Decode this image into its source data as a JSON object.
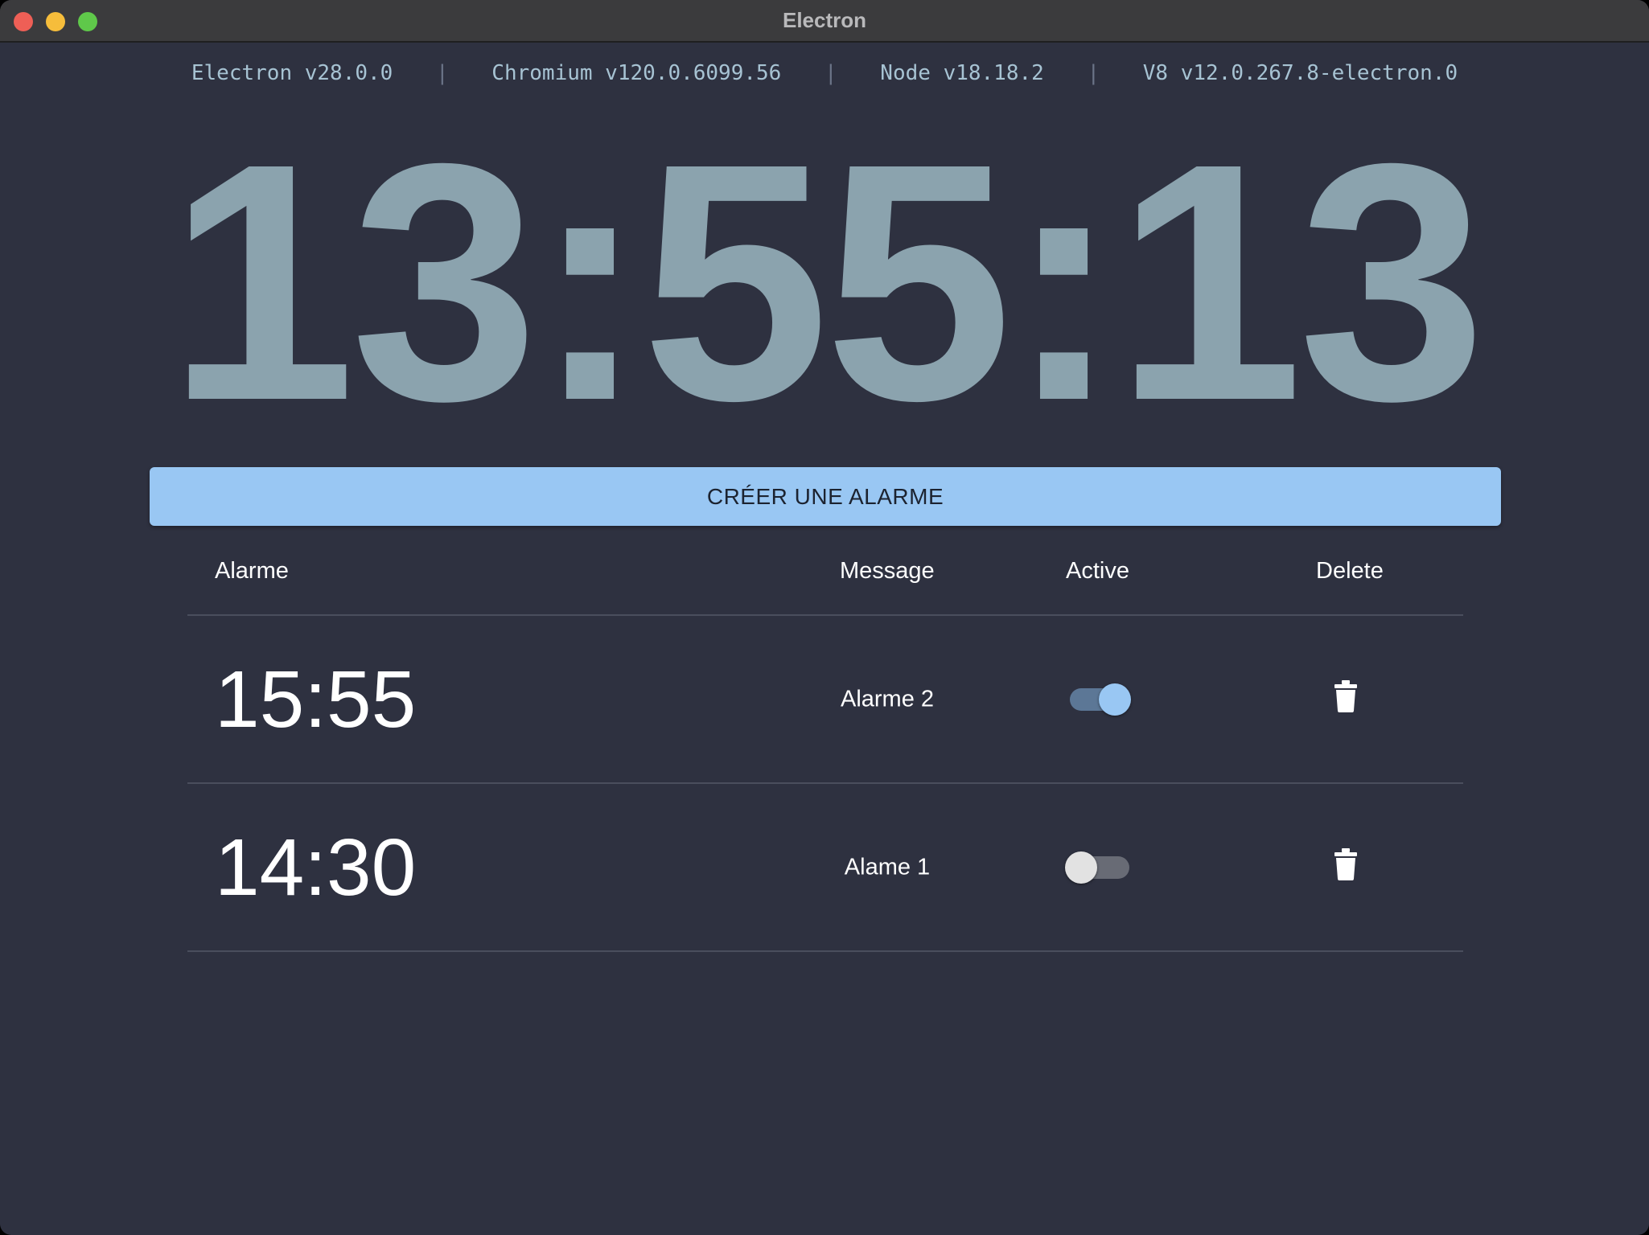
{
  "window": {
    "title": "Electron"
  },
  "versions": {
    "electron": "Electron v28.0.0",
    "chromium": "Chromium v120.0.6099.56",
    "node": "Node v18.18.2",
    "v8": "V8 v12.0.267.8-electron.0"
  },
  "clock": {
    "time": "13:55:13"
  },
  "create_button": {
    "label": "CRÉER UNE ALARME"
  },
  "table": {
    "headers": {
      "alarm": "Alarme",
      "message": "Message",
      "active": "Active",
      "delete": "Delete"
    },
    "rows": [
      {
        "time": "15:55",
        "message": "Alarme 2",
        "active": true
      },
      {
        "time": "14:30",
        "message": "Alame 1",
        "active": false
      }
    ]
  },
  "icons": {
    "delete": "trash-icon",
    "window_controls": [
      "close-icon",
      "minimize-icon",
      "maximize-icon"
    ]
  },
  "colors": {
    "background": "#2e3140",
    "accent": "#99c7f3",
    "clock": "#8ba3ae",
    "versions": "#a7c3d3"
  }
}
